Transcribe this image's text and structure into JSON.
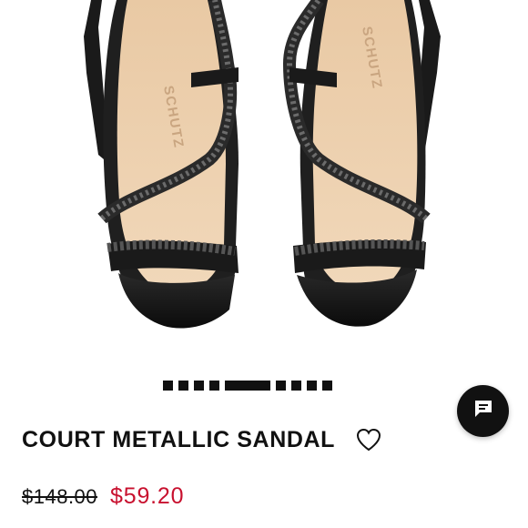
{
  "product": {
    "image_brand_text": "SCHUTZ",
    "title": "COURT METALLIC SANDAL",
    "original_price": "$148.00",
    "sale_price": "$59.20"
  },
  "carousel": {
    "total_images": 9,
    "active_index": 4
  },
  "icons": {
    "wishlist": "heart-outline-icon",
    "chat": "chat-bubble-icon"
  },
  "colors": {
    "sale_price": "#c8102e",
    "text": "#111111",
    "chat_button_bg": "#111111"
  }
}
